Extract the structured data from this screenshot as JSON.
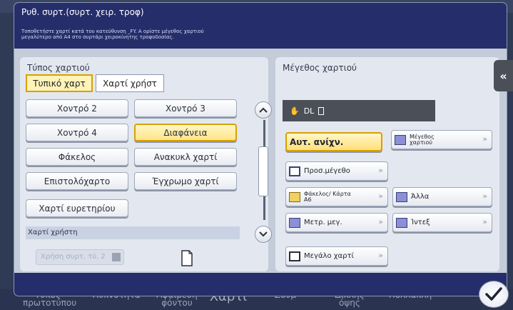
{
  "dialog": {
    "title": "Ρυθ. συρτ.(συρτ. χειρ. τροφ)",
    "subtitle": "Τοποθετήστε χαρτί κατά του κατεύθυνση _FY. Α ορίστε μέγεθος χαρτιού μεγαλύτερο από Α4 στο συρτάρι χειροκίνητης τροφοδοσίας."
  },
  "paper_type": {
    "label": "Τύπος χαρτιού",
    "tabs": [
      "Τυπικό χαρτ",
      "Χαρτί χρήστ"
    ],
    "buttons": {
      "heavy2": "Χοντρό 2",
      "heavy3": "Χοντρό 3",
      "heavy4": "Χοντρό 4",
      "transparency": "Διαφάνεια",
      "envelope": "Φάκελος",
      "recycled": "Ανακυκλ χαρτί",
      "letterhead": "Επιστολόχαρτο",
      "colored": "Έγχρωμο χαρτί",
      "index": "Χαρτί ευρετηρίου"
    },
    "custom_label": "Χαρτί χρήστη",
    "custom_field": "Χρήση συρτ. τύ. 2"
  },
  "paper_size": {
    "label": "Μέγεθος χαρτιού",
    "display": "DL",
    "buttons": {
      "auto": "Αυτ. ανίχν.",
      "size": "Μέγεθος χαρτιού",
      "custom": "Προσ.μέγεθο",
      "envelope": "Φάκελος/ Κάρτα Α6",
      "other": "Άλλα",
      "photo": "Μετρ. μεγ.",
      "tabs": "Ίντεξ",
      "wide": "Μεγάλο χαρτί"
    }
  },
  "background_bar": {
    "item1": "Τύπος πρωτοτύπου",
    "item2": "Πυκνότητα",
    "item3": "Αφαίρεση φόντου",
    "item4": "Χαρτί",
    "item5": "Ζουμ",
    "item6": "Διπλής όψης",
    "item7": "Πολλαπλή"
  },
  "colors": {
    "header": "#252d6b",
    "selected_fill": "#ffe588",
    "selected_border": "#d9a000",
    "panel": "#e3e8f0"
  }
}
